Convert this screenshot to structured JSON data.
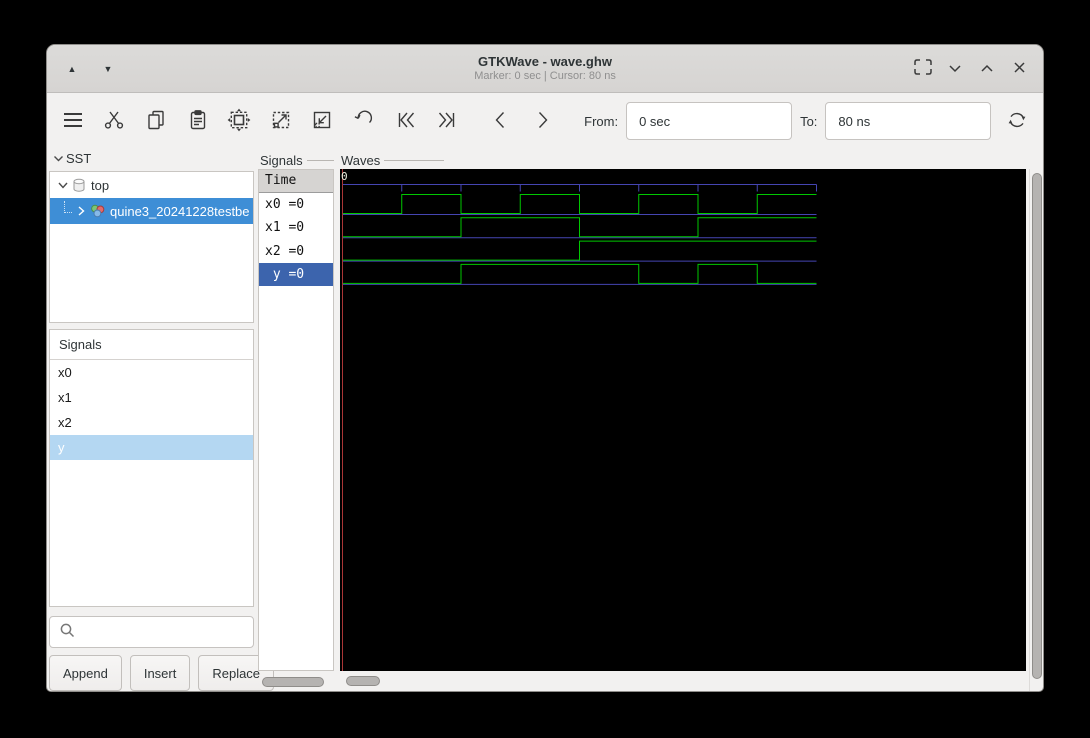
{
  "titlebar": {
    "title": "GTKWave - wave.ghw",
    "subtitle": "Marker: 0 sec | Cursor: 80 ns"
  },
  "toolbar": {
    "from_label": "From:",
    "from_value": "0 sec",
    "to_label": "To:",
    "to_value": "80 ns",
    "icons": [
      "menu",
      "cut",
      "copy",
      "paste",
      "zoom-fit",
      "zoom-in",
      "zoom-out",
      "undo",
      "skip-to-start",
      "skip-to-end",
      "step-left",
      "step-right",
      "reload"
    ]
  },
  "sst": {
    "header": "SST",
    "items": [
      {
        "label": "top",
        "expanded": true
      },
      {
        "label": "quine3_20241228testbe",
        "selected": true
      }
    ]
  },
  "signal_list": {
    "header": "Signals",
    "items": [
      {
        "label": "x0"
      },
      {
        "label": "x1"
      },
      {
        "label": "x2"
      },
      {
        "label": "y",
        "selected": true
      }
    ],
    "buttons": {
      "append": "Append",
      "insert": "Insert",
      "replace": "Replace"
    }
  },
  "signals_column": {
    "frame_label": "Signals",
    "time_header": "Time",
    "rows": [
      {
        "text": "x0 =0"
      },
      {
        "text": "x1 =0"
      },
      {
        "text": "x2 =0"
      },
      {
        "text": " y =0",
        "selected": true
      }
    ]
  },
  "waves": {
    "frame_label": "Waves",
    "origin_label": "0",
    "chart_data": {
      "type": "digital-waveform",
      "time_unit": "ns",
      "t_start": 0,
      "t_end": 80,
      "step": 10,
      "tick_interval": 10,
      "marker_time": 0,
      "signals": [
        {
          "name": "x0",
          "values": [
            0,
            1,
            0,
            1,
            0,
            1,
            0,
            1
          ]
        },
        {
          "name": "x1",
          "values": [
            0,
            0,
            1,
            1,
            0,
            0,
            1,
            1
          ]
        },
        {
          "name": "x2",
          "values": [
            0,
            0,
            0,
            0,
            1,
            1,
            1,
            1
          ]
        },
        {
          "name": "y",
          "values": [
            0,
            0,
            1,
            1,
            1,
            0,
            1,
            0
          ]
        }
      ],
      "colors": {
        "trace": "#00c800",
        "grid": "#4545b2",
        "marker": "#aa3636",
        "canvas": "#000000",
        "time_label": "#eef2e2"
      }
    }
  }
}
